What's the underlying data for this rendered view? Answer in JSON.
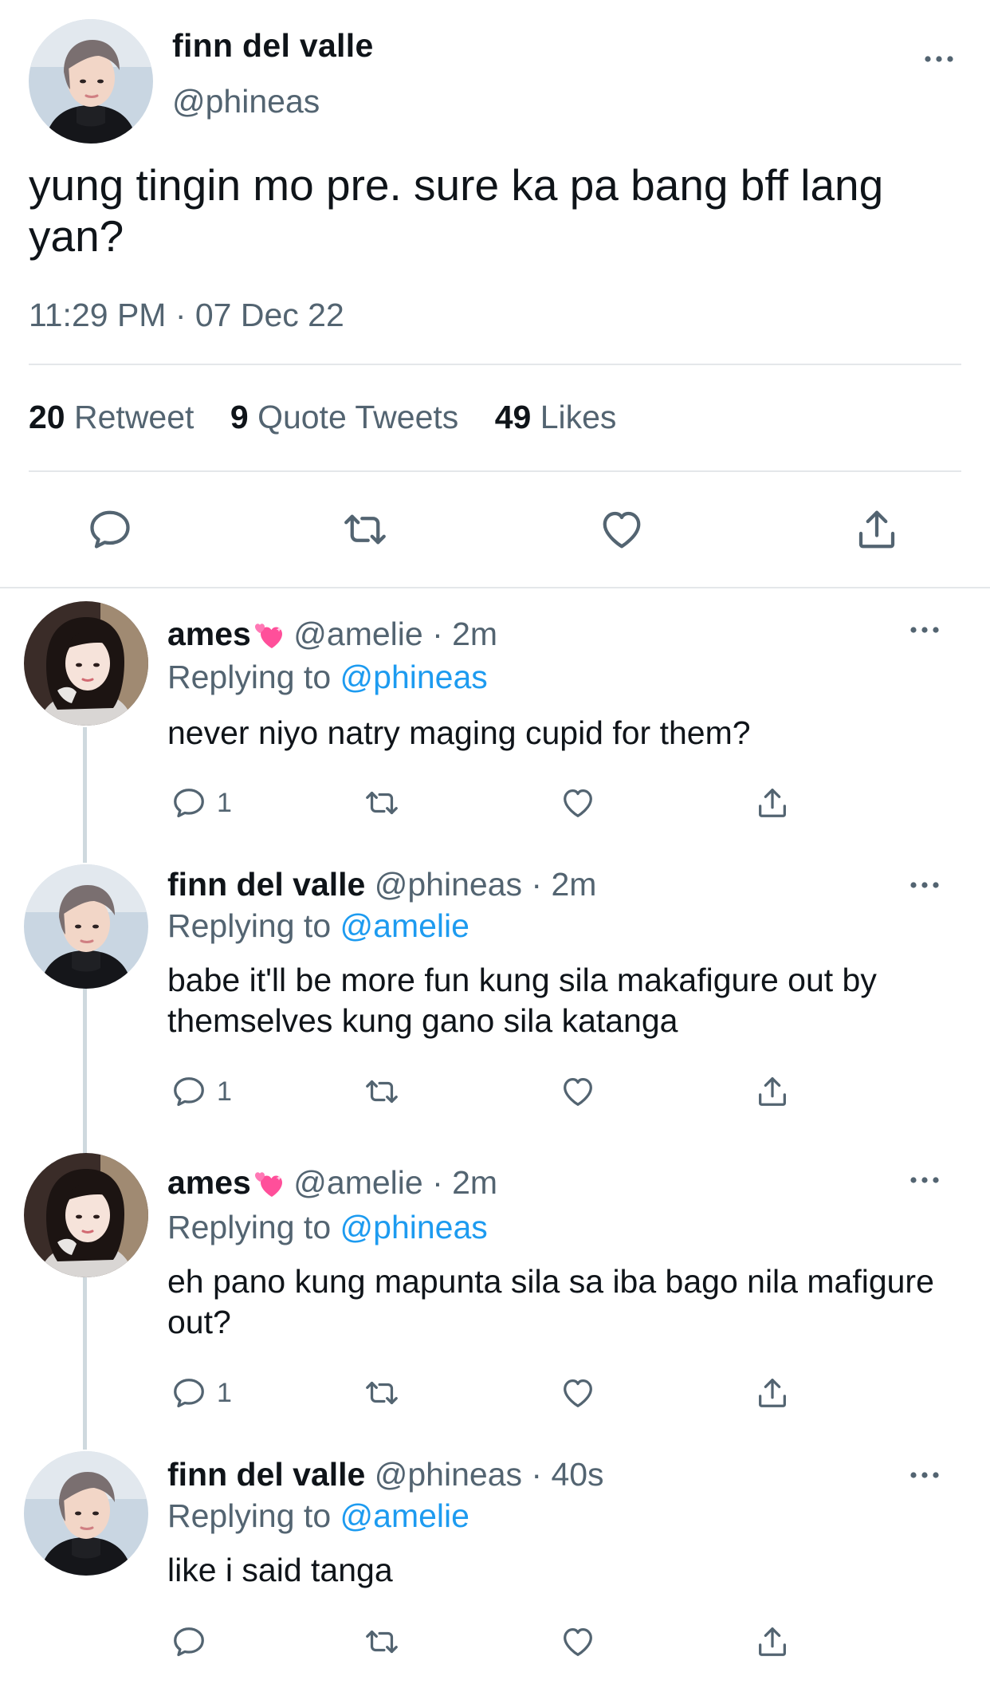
{
  "main": {
    "author_name": "finn del valle",
    "author_handle": "@phineas",
    "text": "yung tingin mo pre. sure ka pa bang bff lang yan?",
    "timestamp": "11:29 PM · 07 Dec 22",
    "stats": {
      "retweets_count": "20",
      "retweets_label": "Retweet",
      "quotes_count": "9",
      "quotes_label": "Quote Tweets",
      "likes_count": "49",
      "likes_label": "Likes"
    }
  },
  "replies": [
    {
      "name": "ames",
      "handle": "@amelie",
      "time": "2m",
      "replying_prefix": "Replying to",
      "replying_to": "@phineas",
      "text": "never niyo natry maging cupid for them?",
      "reply_count": "1"
    },
    {
      "name": "finn del valle",
      "handle": "@phineas",
      "time": "2m",
      "replying_prefix": "Replying to",
      "replying_to": "@amelie",
      "text": "babe it'll be more fun kung sila makafigure out by themselves kung gano sila katanga",
      "reply_count": "1"
    },
    {
      "name": "ames",
      "handle": "@amelie",
      "time": "2m",
      "replying_prefix": "Replying to",
      "replying_to": "@phineas",
      "text": "eh pano kung mapunta sila sa iba bago nila mafigure out?",
      "reply_count": "1"
    },
    {
      "name": "finn del valle",
      "handle": "@phineas",
      "time": "40s",
      "replying_prefix": "Replying to",
      "replying_to": "@amelie",
      "text": "like i said tanga",
      "reply_count": ""
    }
  ],
  "icons": {
    "more": "more-horizontal-icon",
    "reply": "reply-bubble-icon",
    "retweet": "retweet-icon",
    "like": "heart-outline-icon",
    "share": "share-upload-icon",
    "name_emoji": "pink-hearts-emoji-icon"
  },
  "colors": {
    "text_primary": "#0f1419",
    "text_secondary": "#536471",
    "link": "#1d9bf0",
    "divider": "#e4e7ea",
    "thread_line": "#cfd9de",
    "emoji_pink": "#ff4f9a"
  }
}
